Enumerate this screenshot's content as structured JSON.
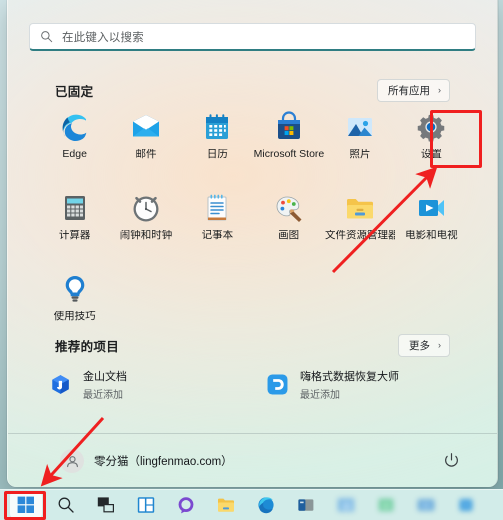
{
  "search": {
    "placeholder": "在此键入以搜索",
    "icon": "search-icon"
  },
  "pinned": {
    "title": "已固定",
    "all_apps_label": "所有应用",
    "chevron": "›",
    "apps": [
      {
        "name": "Edge",
        "icon": "edge-icon"
      },
      {
        "name": "邮件",
        "icon": "mail-icon"
      },
      {
        "name": "日历",
        "icon": "calendar-icon"
      },
      {
        "name": "Microsoft Store",
        "icon": "microsoft-store-icon"
      },
      {
        "name": "照片",
        "icon": "photos-icon"
      },
      {
        "name": "设置",
        "icon": "settings-gear-icon"
      },
      {
        "name": "计算器",
        "icon": "calculator-icon"
      },
      {
        "name": "闹钟和时钟",
        "icon": "clock-icon"
      },
      {
        "name": "记事本",
        "icon": "notepad-icon"
      },
      {
        "name": "画图",
        "icon": "paint-palette-icon"
      },
      {
        "name": "文件资源管理器",
        "icon": "file-explorer-folder-icon"
      },
      {
        "name": "电影和电视",
        "icon": "movies-tv-icon"
      },
      {
        "name": "使用技巧",
        "icon": "lightbulb-tips-icon"
      }
    ]
  },
  "recommended": {
    "title": "推荐的项目",
    "more_label": "更多",
    "chevron": "›",
    "items": [
      {
        "name": "金山文档",
        "subtitle": "最近添加",
        "icon": "wps-document-icon"
      },
      {
        "name": "嗨格式数据恢复大师",
        "subtitle": "最近添加",
        "icon": "data-recovery-icon"
      }
    ]
  },
  "user": {
    "name": "零分猫（lingfenmao.com）",
    "avatar_icon": "user-avatar-icon",
    "power_icon": "power-icon"
  },
  "taskbar": {
    "items": [
      {
        "icon": "windows-start-icon",
        "active": true,
        "blurred": false
      },
      {
        "icon": "search-icon",
        "active": false,
        "blurred": false
      },
      {
        "icon": "task-view-icon",
        "active": false,
        "blurred": false
      },
      {
        "icon": "widgets-icon",
        "active": false,
        "blurred": false
      },
      {
        "icon": "chat-icon",
        "active": false,
        "blurred": false
      },
      {
        "icon": "file-explorer-icon",
        "active": false,
        "blurred": false
      },
      {
        "icon": "edge-icon",
        "active": false,
        "blurred": false
      },
      {
        "icon": "app-icon",
        "active": false,
        "blurred": false
      },
      {
        "icon": "app-icon-blurred",
        "active": false,
        "blurred": true
      },
      {
        "icon": "app-icon-blurred",
        "active": false,
        "blurred": true
      },
      {
        "icon": "app-icon-blurred",
        "active": false,
        "blurred": true
      },
      {
        "icon": "app-icon-blurred",
        "active": false,
        "blurred": true
      }
    ]
  },
  "annotations": {
    "highlight_color": "#f01f1f",
    "boxes": [
      {
        "target": "设置",
        "name": "settings-highlight-box"
      },
      {
        "target": "windows-start-icon",
        "name": "start-button-highlight-box"
      }
    ],
    "arrows": [
      {
        "name": "arrow-to-settings",
        "points_to": "设置"
      },
      {
        "name": "arrow-to-start-button",
        "points_to": "windows-start-icon"
      }
    ]
  }
}
